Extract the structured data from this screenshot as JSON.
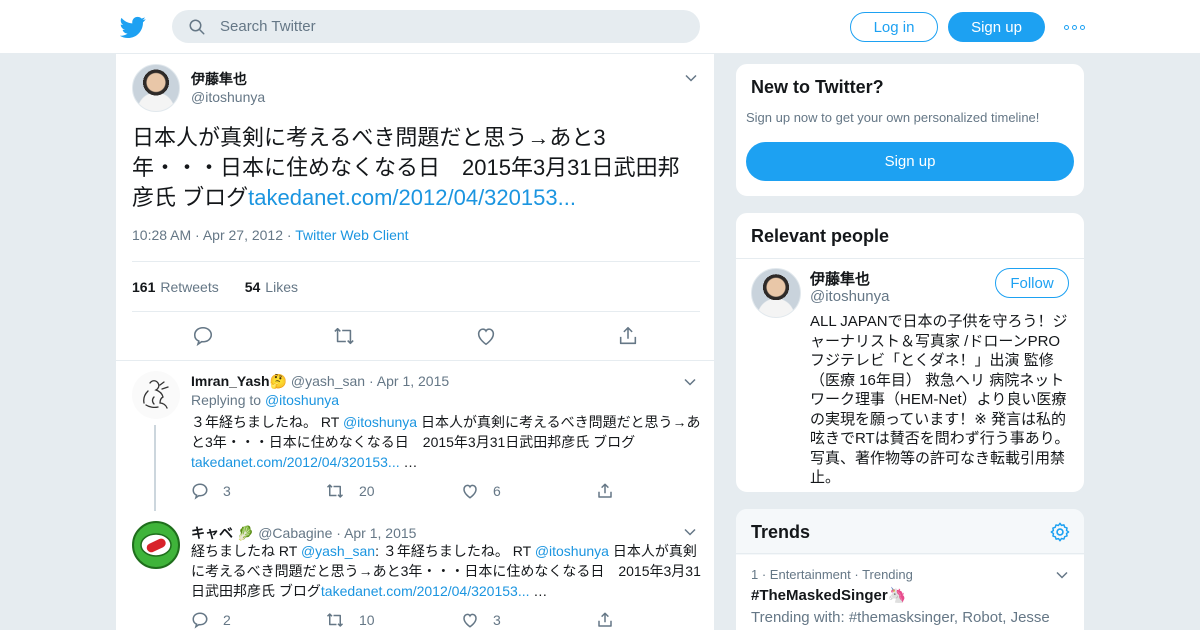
{
  "header": {
    "search_placeholder": "Search Twitter",
    "login_label": "Log in",
    "signup_label": "Sign up"
  },
  "tweet": {
    "name": "伊藤隼也",
    "handle": "@itoshunya",
    "text": "日本人が真剣に考えるべき問題だと思う→あと3年・・・日本に住めなくなる日　2015年3月31日武田邦彦氏 ブログ",
    "link": "takedanet.com/2012/04/320153...",
    "time": "10:28 AM",
    "date": "Apr 27, 2012",
    "client": "Twitter Web Client",
    "retweets_count": "161",
    "retweets_label": "Retweets",
    "likes_count": "54",
    "likes_label": "Likes"
  },
  "replies": [
    {
      "name": "Imran_Yash🤔",
      "handle": "@yash_san",
      "date": "Apr 1, 2015",
      "replying_label": "Replying to",
      "replying_to": "@itoshunya",
      "text_before": "３年経ちましたね。 RT ",
      "mention": "@itoshunya",
      "text_after": " 日本人が真剣に考えるべき問題だと思う→あと3年・・・日本に住めなくなる日　2015年3月31日武田邦彦氏 ブログ",
      "link": "takedanet.com/2012/04/320153...",
      "ellipsis": " …",
      "replies": "3",
      "retweets": "20",
      "likes": "6"
    },
    {
      "name": "キャベ 🥬",
      "handle": "@Cabagine",
      "date": "Apr 1, 2015",
      "text_before": "経ちましたね RT ",
      "mention1": "@yash_san",
      "text_mid": ": ３年経ちましたね。 RT ",
      "mention2": "@itoshunya",
      "text_after": " 日本人が真剣に考えるべき問題だと思う→あと3年・・・日本に住めなくなる日　2015年3月31日武田邦彦氏 ブログ",
      "link": "takedanet.com/2012/04/320153...",
      "ellipsis": " …",
      "replies": "2",
      "retweets": "10",
      "likes": "3"
    }
  ],
  "new_to_twitter": {
    "title": "New to Twitter?",
    "subtitle": "Sign up now to get your own personalized timeline!",
    "button": "Sign up"
  },
  "relevant_people": {
    "title": "Relevant people",
    "name": "伊藤隼也",
    "handle": "@itoshunya",
    "follow_label": "Follow",
    "bio": "ALL JAPANで日本の子供を守ろう！ジャーナリスト＆写真家 /ドローンPRO フジテレビ「とくダネ！」出演 監修（医療 16年目） 救急ヘリ 病院ネットワーク理事（HEM-Net）より良い医療の実現を願っています！※ 発言は私的呟きでRTは賛否を問わず行う事あり。写真、著作物等の許可なき転載引用禁止。"
  },
  "trends": {
    "title": "Trends",
    "items": [
      {
        "rank": "1",
        "category": "Entertainment",
        "status": "Trending",
        "name": "#TheMaskedSinger🦄",
        "trending_with": "Trending with: #themasksinger, Robot, Jesse McC..."
      }
    ]
  },
  "colors": {
    "accent": "#1da1f2",
    "link": "#1b95e0",
    "muted": "#657786",
    "background": "#e6ecf0"
  }
}
